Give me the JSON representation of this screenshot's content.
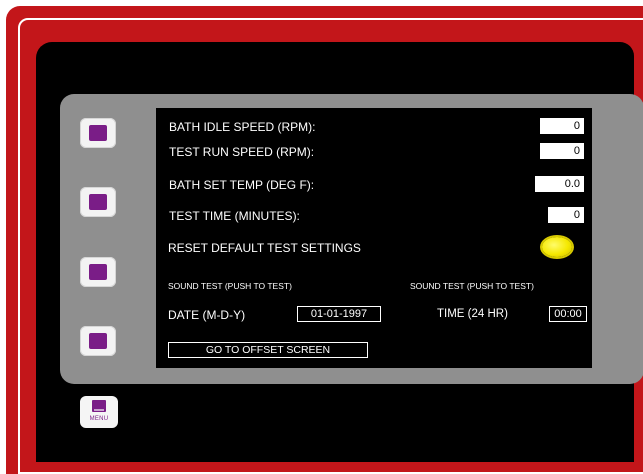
{
  "colors": {
    "frame": "#c3161a",
    "screen": "#000000",
    "panel": "#8f8f8f",
    "button_accent": "#7a1d87",
    "indicator": "#f5e800"
  },
  "side_buttons": [
    {
      "icon": "square-button-icon"
    },
    {
      "icon": "square-button-icon"
    },
    {
      "icon": "square-button-icon"
    },
    {
      "icon": "square-button-icon"
    }
  ],
  "menu_button": {
    "label": "MENU",
    "icon": "menu-icon"
  },
  "settings": {
    "bath_idle_speed": {
      "label": "BATH IDLE SPEED (RPM):",
      "value": "0"
    },
    "test_run_speed": {
      "label": "TEST RUN SPEED (RPM):",
      "value": "0"
    },
    "bath_set_temp": {
      "label": "BATH SET TEMP (DEG F):",
      "value": "0.0"
    },
    "test_time": {
      "label": "TEST TIME (MINUTES):",
      "value": "0"
    }
  },
  "reset": {
    "label": "RESET DEFAULT TEST SETTINGS"
  },
  "sound_test_left": "SOUND TEST (PUSH TO TEST)",
  "sound_test_right": "SOUND TEST (PUSH TO TEST)",
  "date": {
    "label": "DATE (M-D-Y)",
    "value": "01-01-1997"
  },
  "time": {
    "label": "TIME (24 HR)",
    "value": "00:00"
  },
  "offset_button": {
    "label": "GO TO OFFSET SCREEN"
  }
}
